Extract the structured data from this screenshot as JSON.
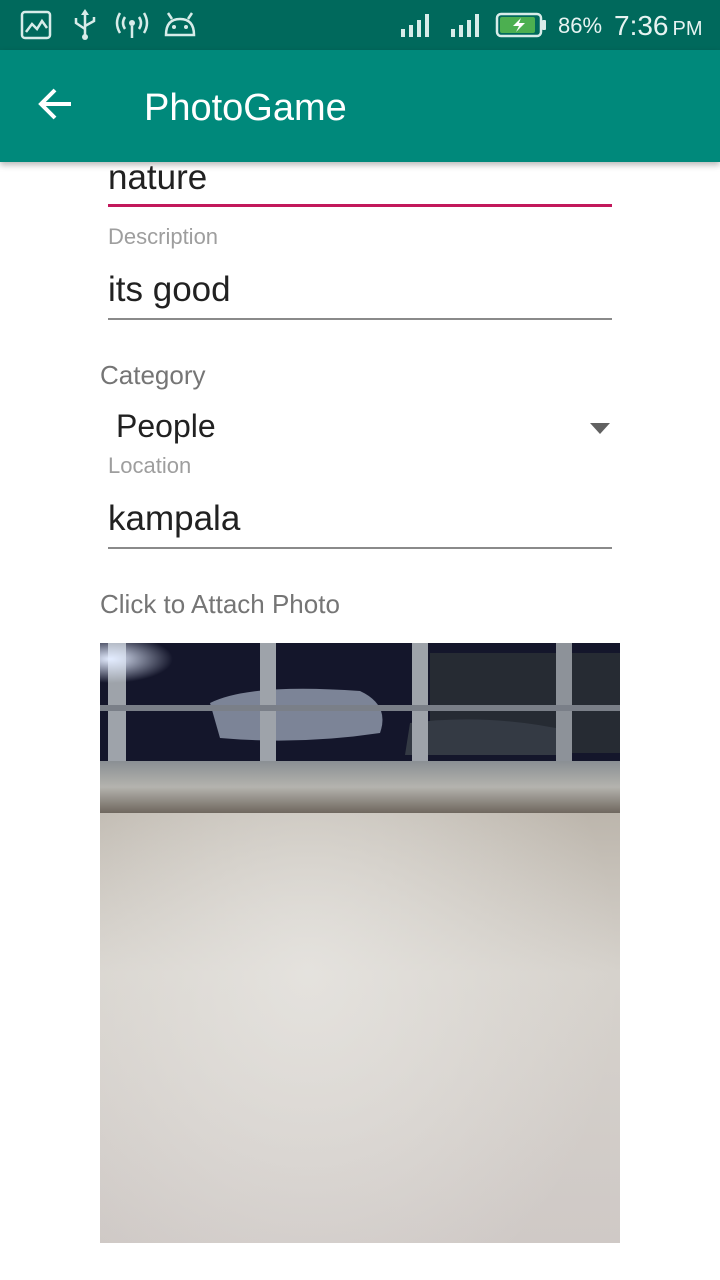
{
  "status_bar": {
    "battery_percent": "86%",
    "time": "7:36",
    "ampm": "PM",
    "icons": [
      "image-notification-icon",
      "usb-icon",
      "hotspot-icon",
      "android-debug-icon",
      "signal-icon",
      "signal-icon",
      "battery-charging-icon"
    ]
  },
  "app_bar": {
    "title": "PhotoGame",
    "back_icon": "arrow-back-icon"
  },
  "form": {
    "title_value": "nature",
    "description_label": "Description",
    "description_value": "its good",
    "category_label": "Category",
    "category_selected": "People",
    "location_label": "Location",
    "location_value": "kampala",
    "attach_label": "Click to Attach Photo"
  },
  "colors": {
    "status_bar": "#00695c",
    "app_bar": "#00897b",
    "focus_underline": "#c2185b"
  }
}
